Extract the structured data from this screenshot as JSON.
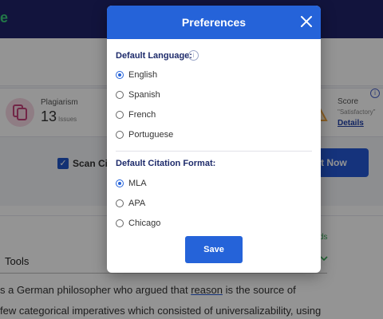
{
  "background": {
    "logo_fragment": "e",
    "stats": {
      "plagiarism": {
        "title": "Plagiarism",
        "count": "13",
        "unit": "Issues",
        "icon": "copy-icon"
      },
      "score": {
        "title": "Score",
        "subtitle": "\"Satisfactory\"",
        "details_label": "Details",
        "info_symbol": "i"
      }
    },
    "scan_citations_label": "Scan Cite",
    "draft_button_label": "ft Now",
    "words_fragment": "ds",
    "tools_label": "Tools",
    "paragraph": {
      "line1_before": "s a German philosopher who argued that ",
      "line1_link": "reason",
      "line1_after": " is the source of",
      "line2": "few categorical imperatives which consisted of universalizability, using"
    }
  },
  "modal": {
    "title": "Preferences",
    "close_symbol": "✕",
    "language_section": {
      "title": "Default Language:",
      "info_symbol": "i",
      "options": [
        "English",
        "Spanish",
        "French",
        "Portuguese"
      ],
      "selected": "English"
    },
    "citation_section": {
      "title": "Default Citation Format:",
      "options": [
        "MLA",
        "APA",
        "Chicago"
      ],
      "selected": "MLA"
    },
    "save_label": "Save"
  },
  "colors": {
    "accent": "#2563d9",
    "topbar": "#1f2369",
    "section_title": "#1e2b6b",
    "overlay": "rgba(0,0,0,0.42)"
  }
}
